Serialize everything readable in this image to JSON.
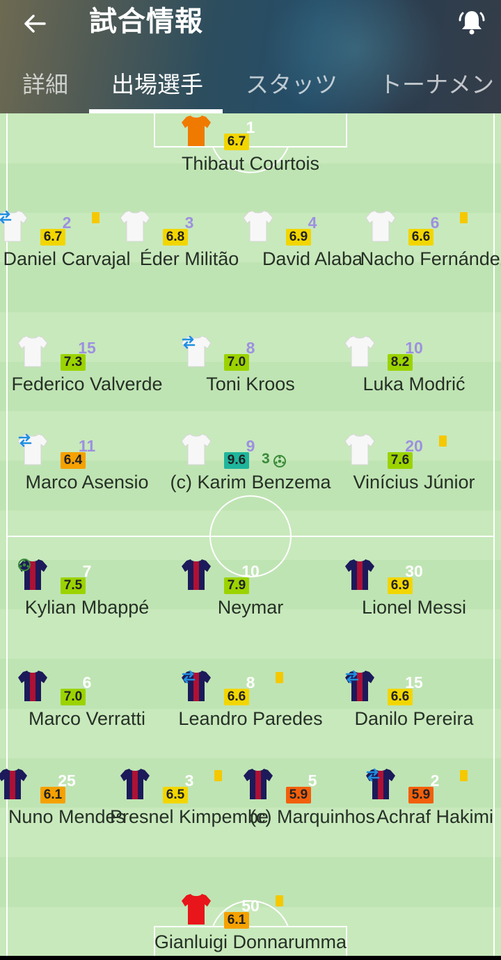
{
  "header": {
    "title": "試合情報"
  },
  "tabs": [
    {
      "label": "詳細"
    },
    {
      "label": "出場選手"
    },
    {
      "label": "スタッツ"
    },
    {
      "label": "トーナメント"
    }
  ],
  "players": {
    "courtois": {
      "name": "Thibaut Courtois",
      "number": "1",
      "rating": "6.7"
    },
    "carvajal": {
      "name": "Daniel Carvajal",
      "number": "2",
      "rating": "6.7"
    },
    "militao": {
      "name": "Éder Militão",
      "number": "3",
      "rating": "6.8"
    },
    "alaba": {
      "name": "David Alaba",
      "number": "4",
      "rating": "6.9"
    },
    "nacho": {
      "name": "Nacho Fernández",
      "number": "6",
      "rating": "6.6"
    },
    "valverde": {
      "name": "Federico Valverde",
      "number": "15",
      "rating": "7.3"
    },
    "kroos": {
      "name": "Toni Kroos",
      "number": "8",
      "rating": "7.0"
    },
    "modric": {
      "name": "Luka Modrić",
      "number": "10",
      "rating": "8.2"
    },
    "asensio": {
      "name": "Marco Asensio",
      "number": "11",
      "rating": "6.4"
    },
    "benzema": {
      "name": "(c) Karim Benzema",
      "number": "9",
      "rating": "9.6",
      "goals": "3"
    },
    "vinicius": {
      "name": "Vinícius Júnior",
      "number": "20",
      "rating": "7.6"
    },
    "mbappe": {
      "name": "Kylian Mbappé",
      "number": "7",
      "rating": "7.5"
    },
    "neymar": {
      "name": "Neymar",
      "number": "10",
      "rating": "7.9"
    },
    "messi": {
      "name": "Lionel Messi",
      "number": "30",
      "rating": "6.9"
    },
    "verratti": {
      "name": "Marco Verratti",
      "number": "6",
      "rating": "7.0"
    },
    "paredes": {
      "name": "Leandro Paredes",
      "number": "8",
      "rating": "6.6"
    },
    "danilo": {
      "name": "Danilo Pereira",
      "number": "15",
      "rating": "6.6"
    },
    "mendes": {
      "name": "Nuno Mendes",
      "number": "25",
      "rating": "6.1"
    },
    "kimpembe": {
      "name": "Presnel Kimpembe",
      "number": "3",
      "rating": "6.5"
    },
    "marquinhos": {
      "name": "(c) Marquinhos",
      "number": "5",
      "rating": "5.9"
    },
    "hakimi": {
      "name": "Achraf Hakimi",
      "number": "2",
      "rating": "5.9"
    },
    "donnarumma": {
      "name": "Gianluigi Donnarumma",
      "number": "50",
      "rating": "6.1"
    }
  },
  "colors": {
    "rating_orange": "#f5a100",
    "rating_yellow": "#f2d600",
    "rating_lime": "#9bd300",
    "rating_teal": "#1fb59d",
    "rating_red": "#f25f0c",
    "shirt_home": "#f7f7f7",
    "shirt_away": "#1c1a5a",
    "shirt_gk_home": "#f07a00",
    "shirt_gk_away": "#e8151a"
  }
}
